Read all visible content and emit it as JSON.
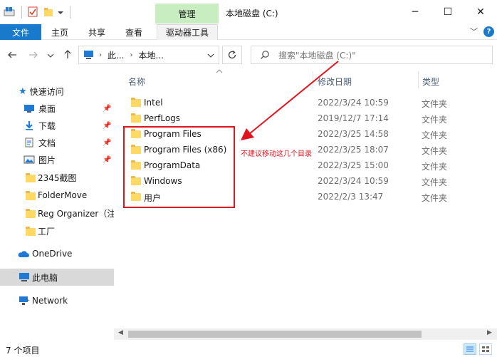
{
  "titlebar": {
    "manage_tab": "管理",
    "title": "本地磁盘 (C:)",
    "minimize": "─",
    "maximize": "☐",
    "close": "✕"
  },
  "ribbon": {
    "tabs": [
      "文件",
      "主页",
      "共享",
      "查看",
      "驱动器工具"
    ],
    "expand": "﹀"
  },
  "address": {
    "crumbs": [
      "此...",
      "本地..."
    ],
    "search_placeholder": "搜索\"本地磁盘 (C:)\""
  },
  "sidebar": {
    "items": [
      {
        "label": "快速访问",
        "icon": "star-icon"
      },
      {
        "label": "桌面",
        "icon": "desktop-icon",
        "pinned": true
      },
      {
        "label": "下载",
        "icon": "download-icon",
        "pinned": true
      },
      {
        "label": "文档",
        "icon": "document-icon",
        "pinned": true
      },
      {
        "label": "图片",
        "icon": "picture-icon",
        "pinned": true
      },
      {
        "label": "2345截图",
        "icon": "folder-icon"
      },
      {
        "label": "FolderMove",
        "icon": "folder-icon"
      },
      {
        "label": "Reg Organizer（注",
        "icon": "folder-icon"
      },
      {
        "label": "工厂",
        "icon": "folder-icon"
      },
      {
        "label": "OneDrive",
        "icon": "cloud-icon"
      },
      {
        "label": "此电脑",
        "icon": "computer-icon"
      },
      {
        "label": "Network",
        "icon": "network-icon"
      }
    ]
  },
  "columns": {
    "name": "名称",
    "date": "修改日期",
    "type": "类型"
  },
  "files": [
    {
      "name": "Intel",
      "date": "2022/3/24 10:59",
      "type": "文件夹"
    },
    {
      "name": "PerfLogs",
      "date": "2019/12/7 17:14",
      "type": "文件夹"
    },
    {
      "name": "Program Files",
      "date": "2022/3/25 14:58",
      "type": "文件夹"
    },
    {
      "name": "Program Files (x86)",
      "date": "2022/3/25 18:07",
      "type": "文件夹"
    },
    {
      "name": "ProgramData",
      "date": "2022/3/25 15:00",
      "type": "文件夹"
    },
    {
      "name": "Windows",
      "date": "2022/3/24 10:59",
      "type": "文件夹"
    },
    {
      "name": "用户",
      "date": "2022/2/3 13:47",
      "type": "文件夹"
    }
  ],
  "annotation": "不建议移动这几个目录",
  "status": {
    "count": "7 个项目"
  },
  "colors": {
    "accent": "#1979ca",
    "manage_tab": "#c7edc0",
    "highlight_red": "#e0141e",
    "folder": "#ffd964"
  }
}
